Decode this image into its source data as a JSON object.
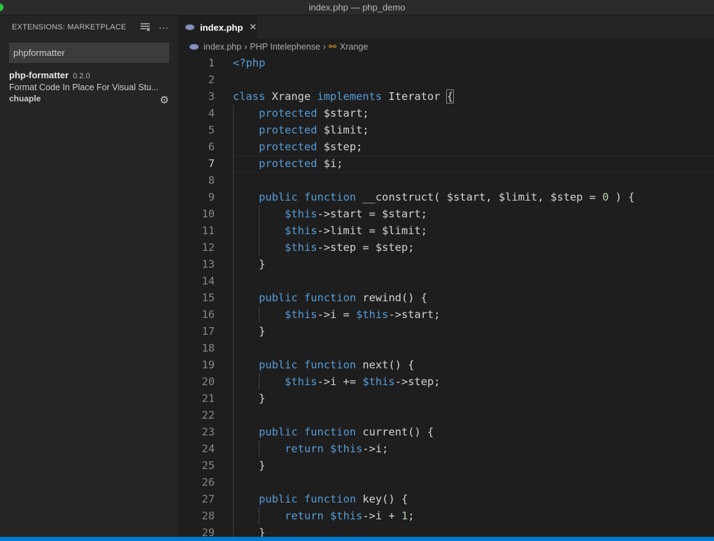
{
  "window": {
    "title": "index.php — php_demo"
  },
  "sidebar": {
    "header": "EXTENSIONS: MARKETPLACE",
    "icons": [
      "clear-filter-icon",
      "more-actions-icon"
    ],
    "search_value": "phpformatter",
    "extension": {
      "name": "php-formatter",
      "version": "0.2.0",
      "description": "Format Code In Place For Visual Stu...",
      "author": "chuaple"
    }
  },
  "editor": {
    "tab": {
      "label": "index.php",
      "icon": "php-file-icon"
    },
    "breadcrumbs": [
      "index.php",
      "PHP Intelephense",
      "Xrange"
    ],
    "active_line": 7,
    "lines": [
      [
        [
          "kw",
          "<?php"
        ]
      ],
      [],
      [
        [
          "kw",
          "class"
        ],
        [
          "plain",
          " Xrange "
        ],
        [
          "kw",
          "implements"
        ],
        [
          "plain",
          " Iterator "
        ],
        [
          "bh",
          "{"
        ]
      ],
      [
        [
          "plain",
          "    "
        ],
        [
          "kw",
          "protected"
        ],
        [
          "plain",
          " $start;"
        ]
      ],
      [
        [
          "plain",
          "    "
        ],
        [
          "kw",
          "protected"
        ],
        [
          "plain",
          " $limit;"
        ]
      ],
      [
        [
          "plain",
          "    "
        ],
        [
          "kw",
          "protected"
        ],
        [
          "plain",
          " $step;"
        ]
      ],
      [
        [
          "plain",
          "    "
        ],
        [
          "kw",
          "protected"
        ],
        [
          "plain",
          " $i;"
        ]
      ],
      [],
      [
        [
          "plain",
          "    "
        ],
        [
          "kw",
          "public"
        ],
        [
          "plain",
          " "
        ],
        [
          "kw",
          "function"
        ],
        [
          "plain",
          " __construct( $start, $limit, $step = "
        ],
        [
          "num",
          "0"
        ],
        [
          "plain",
          " ) {"
        ]
      ],
      [
        [
          "plain",
          "        "
        ],
        [
          "th",
          "$this"
        ],
        [
          "plain",
          "->start = $start;"
        ]
      ],
      [
        [
          "plain",
          "        "
        ],
        [
          "th",
          "$this"
        ],
        [
          "plain",
          "->limit = $limit;"
        ]
      ],
      [
        [
          "plain",
          "        "
        ],
        [
          "th",
          "$this"
        ],
        [
          "plain",
          "->step = $step;"
        ]
      ],
      [
        [
          "plain",
          "    }"
        ]
      ],
      [],
      [
        [
          "plain",
          "    "
        ],
        [
          "kw",
          "public"
        ],
        [
          "plain",
          " "
        ],
        [
          "kw",
          "function"
        ],
        [
          "plain",
          " rewind() {"
        ]
      ],
      [
        [
          "plain",
          "        "
        ],
        [
          "th",
          "$this"
        ],
        [
          "plain",
          "->i = "
        ],
        [
          "th",
          "$this"
        ],
        [
          "plain",
          "->start;"
        ]
      ],
      [
        [
          "plain",
          "    }"
        ]
      ],
      [],
      [
        [
          "plain",
          "    "
        ],
        [
          "kw",
          "public"
        ],
        [
          "plain",
          " "
        ],
        [
          "kw",
          "function"
        ],
        [
          "plain",
          " next() {"
        ]
      ],
      [
        [
          "plain",
          "        "
        ],
        [
          "th",
          "$this"
        ],
        [
          "plain",
          "->i += "
        ],
        [
          "th",
          "$this"
        ],
        [
          "plain",
          "->step;"
        ]
      ],
      [
        [
          "plain",
          "    }"
        ]
      ],
      [],
      [
        [
          "plain",
          "    "
        ],
        [
          "kw",
          "public"
        ],
        [
          "plain",
          " "
        ],
        [
          "kw",
          "function"
        ],
        [
          "plain",
          " current() {"
        ]
      ],
      [
        [
          "plain",
          "        "
        ],
        [
          "kw",
          "return"
        ],
        [
          "plain",
          " "
        ],
        [
          "th",
          "$this"
        ],
        [
          "plain",
          "->i;"
        ]
      ],
      [
        [
          "plain",
          "    }"
        ]
      ],
      [],
      [
        [
          "plain",
          "    "
        ],
        [
          "kw",
          "public"
        ],
        [
          "plain",
          " "
        ],
        [
          "kw",
          "function"
        ],
        [
          "plain",
          " key() {"
        ]
      ],
      [
        [
          "plain",
          "        "
        ],
        [
          "kw",
          "return"
        ],
        [
          "plain",
          " "
        ],
        [
          "th",
          "$this"
        ],
        [
          "plain",
          "->i + "
        ],
        [
          "num",
          "1"
        ],
        [
          "plain",
          ";"
        ]
      ],
      [
        [
          "plain",
          "    }"
        ]
      ]
    ]
  },
  "colors": {
    "keyword": "#569cd6",
    "number": "#b5cea8",
    "text": "#d4d4d4",
    "statusbar": "#007acc"
  }
}
